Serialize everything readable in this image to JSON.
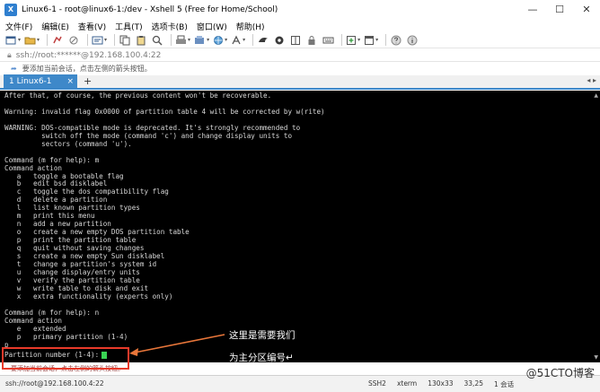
{
  "window": {
    "title": "Linux6-1 - root@linux6-1:/dev - Xshell 5 (Free for Home/School)",
    "controls": [
      "—",
      "☐",
      "✕"
    ]
  },
  "menu": [
    "文件(F)",
    "编辑(E)",
    "查看(V)",
    "工具(T)",
    "选项卡(B)",
    "窗口(W)",
    "帮助(H)"
  ],
  "address": {
    "value": "ssh://root:******@192.168.100.4:22"
  },
  "hint": {
    "text": "要添加当前会话，点击左侧的箭头按钮。"
  },
  "tabs": [
    {
      "label": "1 Linux6-1",
      "close": "×"
    }
  ],
  "tab_add": "+",
  "terminal": {
    "lines": [
      "After that, of course, the previous content won't be recoverable.",
      "",
      "Warning: invalid flag 0x0000 of partition table 4 will be corrected by w(rite)",
      "",
      "WARNING: DOS-compatible mode is deprecated. It's strongly recommended to",
      "         switch off the mode (command 'c') and change display units to",
      "         sectors (command 'u').",
      "",
      "Command (m for help): m",
      "Command action",
      "   a   toggle a bootable flag",
      "   b   edit bsd disklabel",
      "   c   toggle the dos compatibility flag",
      "   d   delete a partition",
      "   l   list known partition types",
      "   m   print this menu",
      "   n   add a new partition",
      "   o   create a new empty DOS partition table",
      "   p   print the partition table",
      "   q   quit without saving changes",
      "   s   create a new empty Sun disklabel",
      "   t   change a partition's system id",
      "   u   change display/entry units",
      "   v   verify the partition table",
      "   w   write table to disk and exit",
      "   x   extra functionality (experts only)",
      "",
      "Command (m for help): n",
      "Command action",
      "   e   extended",
      "   p   primary partition (1-4)",
      "p"
    ],
    "prompt": "Partition number (1-4):",
    "faded_line": "要添加当前会话，点击左侧的箭头按钮。"
  },
  "annotation": {
    "line1": "这里是需要我们",
    "line2": "为主分区编号↵",
    "color": "#e8763a",
    "box_color": "#e83a2a"
  },
  "status": {
    "left": "ssh://root@192.168.100.4:22",
    "items": [
      "SSH2",
      "xterm",
      "130x33",
      "33,25",
      "1 会话"
    ]
  },
  "watermark": "@51CTO博客"
}
